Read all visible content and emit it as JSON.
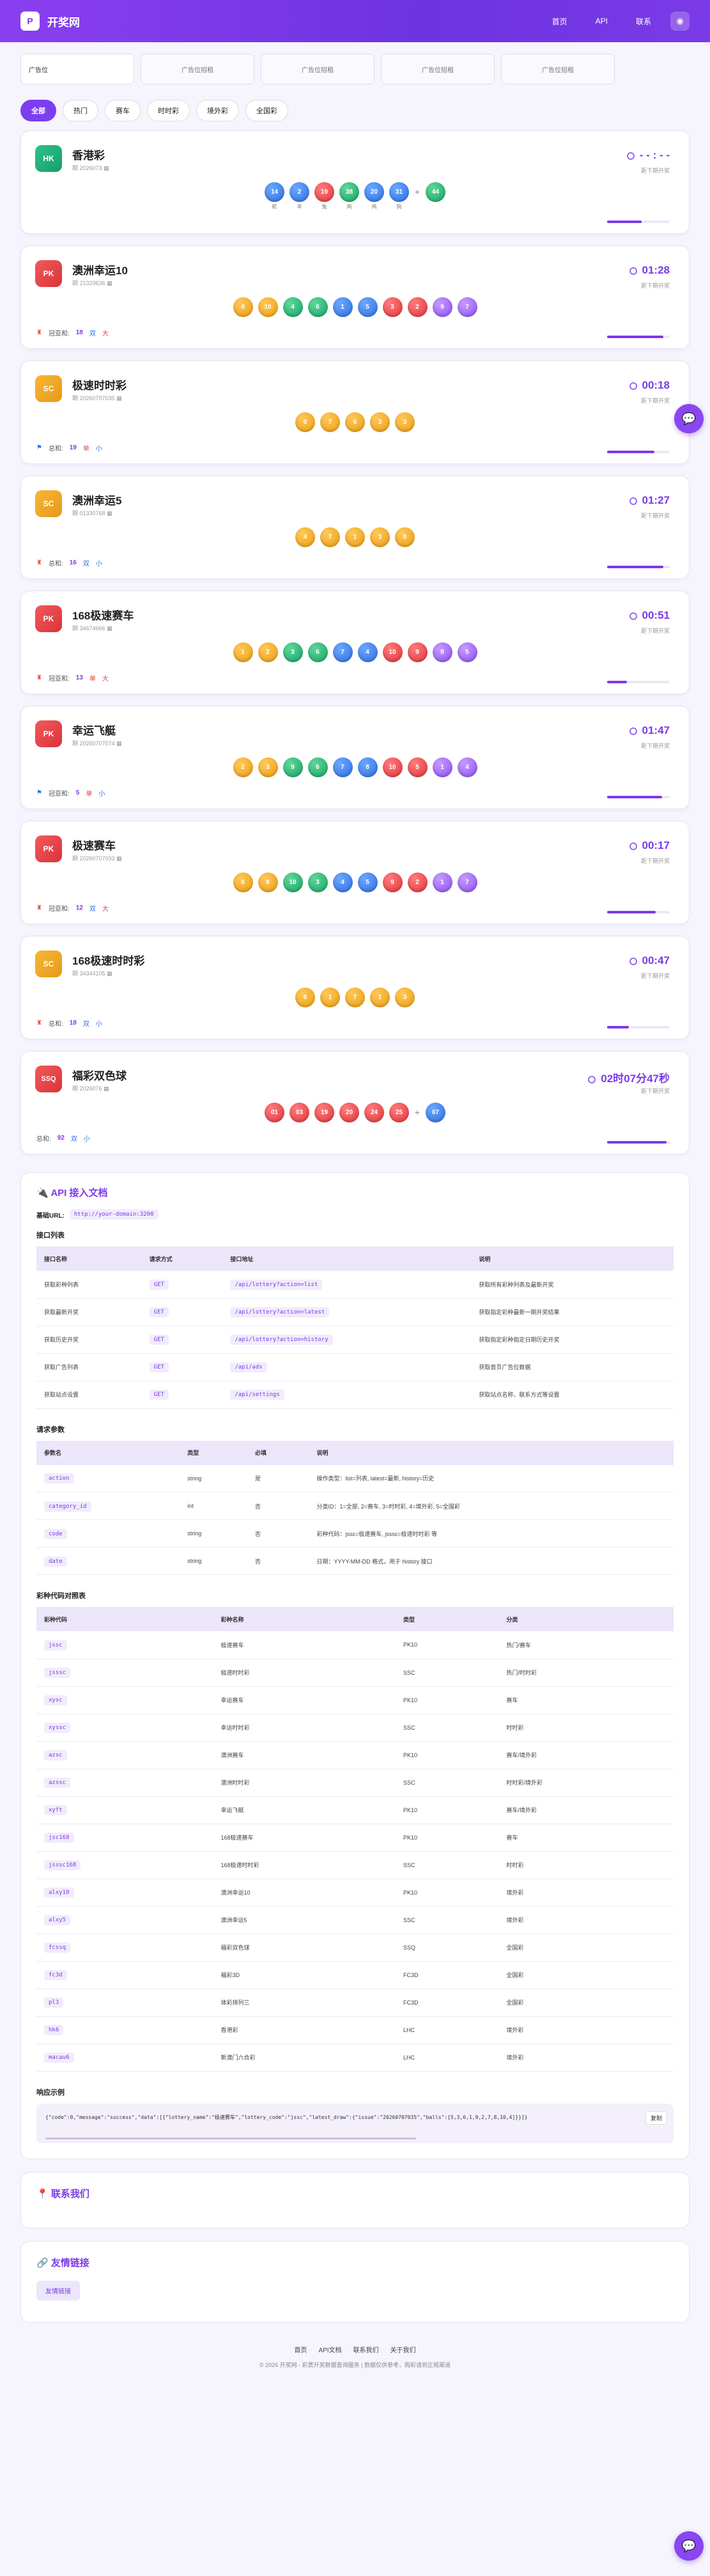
{
  "header": {
    "logo": "P",
    "title": "开奖网",
    "nav": [
      "首页",
      "API",
      "联系"
    ],
    "user_icon": "user-icon"
  },
  "ads": {
    "first": "广告位",
    "items": [
      "广告位招租",
      "广告位招租",
      "广告位招租",
      "广告位招租"
    ]
  },
  "tabs": [
    "全部",
    "热门",
    "赛车",
    "时时彩",
    "境外彩",
    "全国彩"
  ],
  "lotteries": [
    {
      "badge": "HK",
      "cls": "hk",
      "name": "香港彩",
      "issue": "期 2026073 ▦",
      "timer": "- - : - -",
      "next": "距下期开奖",
      "progress": 0.55,
      "balls": [
        {
          "n": "14",
          "c": "blue",
          "z": "蛇"
        },
        {
          "n": "2",
          "c": "blue",
          "z": "羊"
        },
        {
          "n": "19",
          "c": "red",
          "z": "兔"
        },
        {
          "n": "38",
          "c": "green",
          "z": "鸡"
        },
        {
          "n": "20",
          "c": "blue",
          "z": "鸡"
        },
        {
          "n": "31",
          "c": "blue",
          "z": "狗"
        },
        {
          "n": "44",
          "c": "green",
          "z": "",
          "special": true
        }
      ],
      "info": null
    },
    {
      "badge": "PK",
      "cls": "pk",
      "name": "澳洲幸运10",
      "issue": "期 21329636 ▦",
      "timer": "01:28",
      "next": "距下期开奖",
      "progress": 0.9,
      "balls": [
        {
          "n": "8",
          "c": "orange"
        },
        {
          "n": "10",
          "c": "orange"
        },
        {
          "n": "4",
          "c": "green"
        },
        {
          "n": "6",
          "c": "green"
        },
        {
          "n": "1",
          "c": "blue"
        },
        {
          "n": "5",
          "c": "blue"
        },
        {
          "n": "3",
          "c": "red"
        },
        {
          "n": "2",
          "c": "red"
        },
        {
          "n": "9",
          "c": "purple"
        },
        {
          "n": "7",
          "c": "purple"
        }
      ],
      "info": {
        "icon": "♜",
        "iconname": "flag-icon",
        "label": "冠亚和:",
        "num": "18",
        "a": "双",
        "ac": "blue",
        "b": "大",
        "bc": "red"
      }
    },
    {
      "badge": "SC",
      "cls": "sc",
      "name": "极速时时彩",
      "issue": "期 20260707035 ▦",
      "timer": "00:18",
      "next": "距下期开奖",
      "progress": 0.75,
      "balls": [
        {
          "n": "0",
          "c": "orange"
        },
        {
          "n": "7",
          "c": "orange"
        },
        {
          "n": "6",
          "c": "orange"
        },
        {
          "n": "3",
          "c": "orange"
        },
        {
          "n": "3",
          "c": "orange"
        }
      ],
      "info": {
        "icon": "⚑",
        "iconname": "chart-icon",
        "label": "总和:",
        "num": "19",
        "a": "单",
        "ac": "red",
        "b": "小",
        "bc": "blue"
      }
    },
    {
      "badge": "SC",
      "cls": "sc",
      "name": "澳洲幸运5",
      "issue": "期 01330768 ▦",
      "timer": "01:27",
      "next": "距下期开奖",
      "progress": 0.9,
      "balls": [
        {
          "n": "4",
          "c": "orange"
        },
        {
          "n": "7",
          "c": "orange"
        },
        {
          "n": "1",
          "c": "orange"
        },
        {
          "n": "3",
          "c": "orange"
        },
        {
          "n": "0",
          "c": "orange"
        }
      ],
      "info": {
        "icon": "♜",
        "iconname": "flag-icon",
        "label": "总和:",
        "num": "16",
        "a": "双",
        "ac": "blue",
        "b": "小",
        "bc": "blue"
      }
    },
    {
      "badge": "PK",
      "cls": "pk",
      "name": "168极速赛车",
      "issue": "期 34674666 ▦",
      "timer": "00:51",
      "next": "距下期开奖",
      "progress": 0.32,
      "balls": [
        {
          "n": "1",
          "c": "orange"
        },
        {
          "n": "2",
          "c": "orange"
        },
        {
          "n": "3",
          "c": "green"
        },
        {
          "n": "6",
          "c": "green"
        },
        {
          "n": "7",
          "c": "blue"
        },
        {
          "n": "4",
          "c": "blue"
        },
        {
          "n": "10",
          "c": "red"
        },
        {
          "n": "9",
          "c": "red"
        },
        {
          "n": "8",
          "c": "purple"
        },
        {
          "n": "5",
          "c": "purple"
        }
      ],
      "info": {
        "icon": "♜",
        "iconname": "flag-icon",
        "label": "冠亚和:",
        "num": "13",
        "a": "单",
        "ac": "red",
        "b": "大",
        "bc": "red"
      }
    },
    {
      "badge": "PK",
      "cls": "pk",
      "name": "幸运飞艇",
      "issue": "期 20260707074 ▦",
      "timer": "01:47",
      "next": "距下期开奖",
      "progress": 0.88,
      "balls": [
        {
          "n": "2",
          "c": "orange"
        },
        {
          "n": "3",
          "c": "orange"
        },
        {
          "n": "9",
          "c": "green"
        },
        {
          "n": "6",
          "c": "green"
        },
        {
          "n": "7",
          "c": "blue"
        },
        {
          "n": "8",
          "c": "blue"
        },
        {
          "n": "10",
          "c": "red"
        },
        {
          "n": "5",
          "c": "red"
        },
        {
          "n": "1",
          "c": "purple"
        },
        {
          "n": "4",
          "c": "purple"
        }
      ],
      "info": {
        "icon": "⚑",
        "iconname": "chart-icon",
        "label": "冠亚和:",
        "num": "5",
        "a": "单",
        "ac": "red",
        "b": "小",
        "bc": "blue"
      }
    },
    {
      "badge": "PK",
      "cls": "pk",
      "name": "极速赛车",
      "issue": "期 20260707033 ▦",
      "timer": "00:17",
      "next": "距下期开奖",
      "progress": 0.78,
      "balls": [
        {
          "n": "6",
          "c": "orange"
        },
        {
          "n": "8",
          "c": "orange"
        },
        {
          "n": "10",
          "c": "green"
        },
        {
          "n": "3",
          "c": "green"
        },
        {
          "n": "4",
          "c": "blue"
        },
        {
          "n": "5",
          "c": "blue"
        },
        {
          "n": "9",
          "c": "red"
        },
        {
          "n": "2",
          "c": "red"
        },
        {
          "n": "1",
          "c": "purple"
        },
        {
          "n": "7",
          "c": "purple"
        }
      ],
      "info": {
        "icon": "♜",
        "iconname": "flag-icon",
        "label": "冠亚和:",
        "num": "12",
        "a": "双",
        "ac": "blue",
        "b": "大",
        "bc": "red"
      }
    },
    {
      "badge": "SC",
      "cls": "sc",
      "name": "168极速时时彩",
      "issue": "期 34344105 ▦",
      "timer": "00:47",
      "next": "距下期开奖",
      "progress": 0.35,
      "balls": [
        {
          "n": "6",
          "c": "orange"
        },
        {
          "n": "1",
          "c": "orange"
        },
        {
          "n": "7",
          "c": "orange"
        },
        {
          "n": "1",
          "c": "orange"
        },
        {
          "n": "3",
          "c": "orange"
        }
      ],
      "info": {
        "icon": "♜",
        "iconname": "flag-icon",
        "label": "总和:",
        "num": "18",
        "a": "双",
        "ac": "blue",
        "b": "小",
        "bc": "blue"
      }
    },
    {
      "badge": "SSQ",
      "cls": "ssq",
      "name": "福彩双色球",
      "issue": "期 2026076 ▦",
      "timer": "02时07分47秒",
      "next": "距下期开奖",
      "progress": 0.95,
      "balls": [
        {
          "n": "01",
          "c": "red"
        },
        {
          "n": "03",
          "c": "red"
        },
        {
          "n": "19",
          "c": "red"
        },
        {
          "n": "20",
          "c": "red"
        },
        {
          "n": "24",
          "c": "red"
        },
        {
          "n": "25",
          "c": "red"
        },
        {
          "n": "07",
          "c": "blue",
          "special": true
        }
      ],
      "info": {
        "icon": "",
        "iconname": "",
        "label": "总和:",
        "num": "92",
        "a": "双",
        "ac": "blue",
        "b": "小",
        "bc": "blue"
      }
    }
  ],
  "api": {
    "title": "API 接入文档",
    "base_label": "基础URL:",
    "base_url": "http://your-domain:3200",
    "list_title": "接口列表",
    "list_head": [
      "接口名称",
      "请求方式",
      "接口地址",
      "说明"
    ],
    "list_rows": [
      [
        "获取彩种列表",
        "GET",
        "/api/lottery?action=list",
        "获取所有彩种列表及最新开奖"
      ],
      [
        "获取最新开奖",
        "GET",
        "/api/lottery?action=latest",
        "获取指定彩种最新一期开奖结果"
      ],
      [
        "获取历史开奖",
        "GET",
        "/api/lottery?action=history",
        "获取指定彩种指定日期历史开奖"
      ],
      [
        "获取广告列表",
        "GET",
        "/api/ads",
        "获取首页广告位数据"
      ],
      [
        "获取站点设置",
        "GET",
        "/api/settings",
        "获取站点名称、联系方式等设置"
      ]
    ],
    "param_title": "请求参数",
    "param_head": [
      "参数名",
      "类型",
      "必填",
      "说明"
    ],
    "param_rows": [
      [
        "action",
        "string",
        "是",
        "操作类型：list=列表, latest=最新, history=历史"
      ],
      [
        "category_id",
        "int",
        "否",
        "分类ID：1=全部, 2=赛车, 3=时时彩, 4=境外彩, 5=全国彩"
      ],
      [
        "code",
        "string",
        "否",
        "彩种代码：jssc=极速赛车, jsssc=极速时时彩 等"
      ],
      [
        "date",
        "string",
        "否",
        "日期：YYYY-MM-DD 格式，用于 history 接口"
      ]
    ],
    "code_title": "彩种代码对照表",
    "code_head": [
      "彩种代码",
      "彩种名称",
      "类型",
      "分类"
    ],
    "code_rows": [
      [
        "jssc",
        "极速赛车",
        "PK10",
        "热门/赛车"
      ],
      [
        "jsssc",
        "极速时时彩",
        "SSC",
        "热门/时时彩"
      ],
      [
        "xysc",
        "幸运赛车",
        "PK10",
        "赛车"
      ],
      [
        "xyssc",
        "幸运时时彩",
        "SSC",
        "时时彩"
      ],
      [
        "azsc",
        "澳洲赛车",
        "PK10",
        "赛车/境外彩"
      ],
      [
        "azssc",
        "澳洲时时彩",
        "SSC",
        "时时彩/境外彩"
      ],
      [
        "xyft",
        "幸运飞艇",
        "PK10",
        "赛车/境外彩"
      ],
      [
        "jsc168",
        "168极速赛车",
        "PK10",
        "赛车"
      ],
      [
        "jsssc168",
        "168极速时时彩",
        "SSC",
        "时时彩"
      ],
      [
        "alxy10",
        "澳洲幸运10",
        "PK10",
        "境外彩"
      ],
      [
        "alxy5",
        "澳洲幸运5",
        "SSC",
        "境外彩"
      ],
      [
        "fcssq",
        "福彩双色球",
        "SSQ",
        "全国彩"
      ],
      [
        "fc3d",
        "福彩3D",
        "FC3D",
        "全国彩"
      ],
      [
        "pl3",
        "体彩排列三",
        "FC3D",
        "全国彩"
      ],
      [
        "hk6",
        "香港彩",
        "LHC",
        "境外彩"
      ],
      [
        "macau6",
        "新澳门六合彩",
        "LHC",
        "境外彩"
      ]
    ],
    "resp_title": "响应示例",
    "resp_code": "{\"code\":0,\"message\":\"success\",\"data\":[{\"lottery_name\":\"极速赛车\",\"lottery_code\":\"jssc\",\"latest_draw\":{\"issue\":\"20260707035\",\"balls\":[5,3,6,1,9,2,7,8,10,4]}}]}",
    "copy": "复制"
  },
  "contact": {
    "title": "联系我们"
  },
  "links": {
    "title": "友情链接",
    "item": "友情链接"
  },
  "footer": {
    "links": [
      "首页",
      "API文档",
      "联系我们",
      "关于我们"
    ],
    "copyright": "© 2026 开奖网 - 彩票开奖数据查询服务 | 数据仅供参考，购彩请到正规渠道"
  },
  "fab_icon": "chat-icon"
}
